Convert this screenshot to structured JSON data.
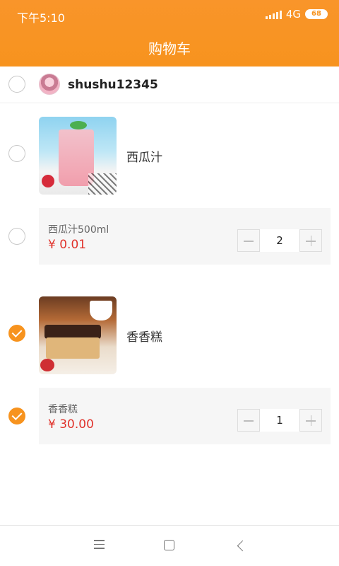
{
  "status_bar": {
    "time": "下午5:10",
    "network": "4G",
    "battery": "68"
  },
  "header": {
    "title": "购物车"
  },
  "shop": {
    "name": "shushu12345",
    "selected": false,
    "avatar_icon": "user-avatar"
  },
  "items": [
    {
      "name": "西瓜汁",
      "spec": "西瓜汁500ml",
      "price": "¥ 0.01",
      "quantity": "2",
      "product_selected": false,
      "spec_selected": false
    },
    {
      "name": "香香糕",
      "spec": "香香糕",
      "price": "¥ 30.00",
      "quantity": "1",
      "product_selected": true,
      "spec_selected": true
    }
  ],
  "colors": {
    "accent": "#f7931e",
    "price": "#e0322b"
  }
}
